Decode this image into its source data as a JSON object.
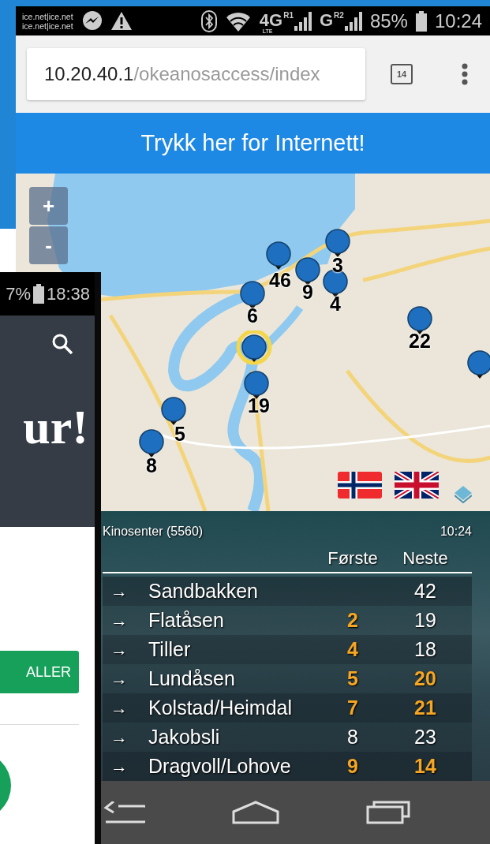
{
  "background_phone": {
    "status": {
      "battery": "7%",
      "time": "18:38"
    },
    "headline": "ur!",
    "button": "ALLER"
  },
  "phone": {
    "status": {
      "carrier_lines": [
        "ice.net|ice.net",
        "ice.net|ice.net"
      ],
      "networks": [
        {
          "type": "4G",
          "roaming": "R1",
          "sub": "LTE"
        },
        {
          "type": "G",
          "roaming": "R2"
        }
      ],
      "battery": "85%",
      "time": "10:24"
    },
    "browser": {
      "url": {
        "host": "10.20.40.1",
        "path": "/okeanosaccess/index"
      },
      "tab_count": "14"
    },
    "internet_button": "Trykk her for Internett!",
    "map": {
      "zoom_in": "+",
      "zoom_out": "-",
      "markers": [
        {
          "label": "9",
          "selected": false
        },
        {
          "label": "3",
          "selected": false
        },
        {
          "label": "46",
          "selected": false
        },
        {
          "label": "4",
          "selected": false
        },
        {
          "label": "6",
          "selected": false
        },
        {
          "selected": true
        },
        {
          "label": "22",
          "selected": false
        },
        {
          "label": "19",
          "selected": false
        },
        {
          "label": "5",
          "selected": false
        },
        {
          "label": "8",
          "selected": false
        },
        {
          "selected": false
        }
      ],
      "languages": [
        {
          "kind": "norwegian"
        },
        {
          "kind": "english"
        }
      ]
    },
    "departures": {
      "stop": "Kinosenter (5560)",
      "time": "10:24",
      "columns": [
        "Første",
        "Neste"
      ],
      "rows": [
        {
          "arrow": "→",
          "route": "Sandbakken",
          "next": {
            "text": "42",
            "realtime": false
          }
        },
        {
          "arrow": "→",
          "route": "Flatåsen",
          "first": {
            "text": "2",
            "realtime": true
          },
          "next": {
            "text": "19",
            "realtime": false
          }
        },
        {
          "arrow": "→",
          "route": "Tiller",
          "first": {
            "text": "4",
            "realtime": true
          },
          "next": {
            "text": "18",
            "realtime": false
          }
        },
        {
          "arrow": "→",
          "route": "Lundåsen",
          "first": {
            "text": "5",
            "realtime": true
          },
          "next": {
            "text": "20",
            "realtime": true
          }
        },
        {
          "arrow": "→",
          "route": "Kolstad/Heimdal",
          "first": {
            "text": "7",
            "realtime": true
          },
          "next": {
            "text": "21",
            "realtime": true
          }
        },
        {
          "arrow": "→",
          "route": "Jakobsli",
          "first": {
            "text": "8",
            "realtime": false
          },
          "next": {
            "text": "23",
            "realtime": false
          }
        },
        {
          "arrow": "→",
          "route": "Dragvoll/Lohove",
          "first": {
            "text": "9",
            "realtime": true
          },
          "next": {
            "text": "14",
            "realtime": true
          }
        }
      ]
    }
  }
}
